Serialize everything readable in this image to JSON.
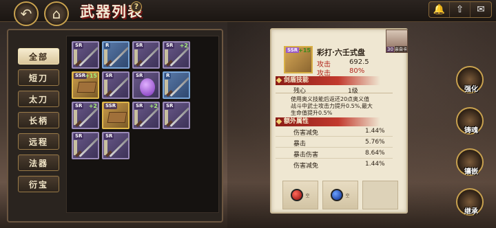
{
  "header": {
    "title": "武器列表",
    "help": "?"
  },
  "categories": [
    "全部",
    "短刀",
    "太刀",
    "长柄",
    "远程",
    "法器",
    "衍宝"
  ],
  "grid": [
    {
      "rank": "SR",
      "plus": "",
      "style": "purple"
    },
    {
      "rank": "R",
      "plus": "",
      "style": "blue"
    },
    {
      "rank": "SR",
      "plus": "",
      "style": "purple"
    },
    {
      "rank": "SR",
      "plus": "+2",
      "style": "purple"
    },
    {
      "rank": "SSR",
      "plus": "+15",
      "style": "gold"
    },
    {
      "rank": "SR",
      "plus": "",
      "style": "purple"
    },
    {
      "rank": "SR",
      "plus": "",
      "style": "purple"
    },
    {
      "rank": "R",
      "plus": "",
      "style": "blue"
    },
    {
      "rank": "SR",
      "plus": "+2",
      "style": "purple"
    },
    {
      "rank": "SSR",
      "plus": "",
      "style": "gold"
    },
    {
      "rank": "SR",
      "plus": "+2",
      "style": "purple"
    },
    {
      "rank": "SR",
      "plus": "",
      "style": "purple"
    },
    {
      "rank": "SR",
      "plus": "",
      "style": "purple"
    },
    {
      "rank": "SR",
      "plus": "",
      "style": "purple"
    }
  ],
  "detail": {
    "rank": "SSR",
    "plus": "+15",
    "name": "彩打·六壬式盘",
    "avatar_level": "30",
    "avatar_name": "亲自卡",
    "stats": [
      {
        "label": "攻击",
        "value": "692.5"
      },
      {
        "label": "攻击",
        "value": "80%"
      }
    ],
    "skill_section": "剑盾技能",
    "skill_name": "残心",
    "skill_level": "1级",
    "skill_desc_1": "使用奥义技能后返还20点奥义值",
    "skill_desc_2": "战斗中武士攻击力提升0.5%,最大",
    "skill_desc_3": "生命值提升0.5%",
    "extra_section": "额外属性",
    "extras": [
      {
        "label": "伤害减免",
        "value": "1.44%"
      },
      {
        "label": "暴击",
        "value": "5.76%"
      },
      {
        "label": "暴击伤害",
        "value": "8.64%"
      },
      {
        "label": "伤害减免",
        "value": "1.44%"
      }
    ],
    "gems": [
      {
        "label": "空",
        "color": "#c8201a"
      },
      {
        "label": "空",
        "color": "#1a5ac8"
      }
    ]
  },
  "side": [
    "强化",
    "铸魂",
    "镶嵌",
    "继承"
  ]
}
